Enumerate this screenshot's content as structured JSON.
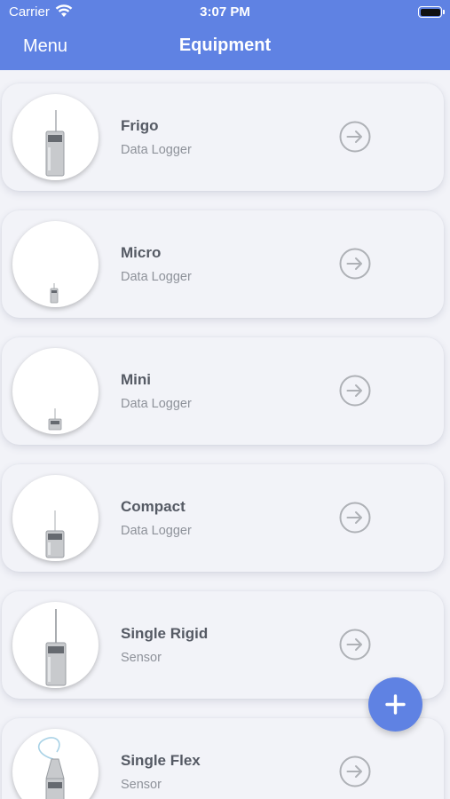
{
  "status_bar": {
    "carrier": "Carrier",
    "time": "3:07 PM"
  },
  "header": {
    "menu_label": "Menu",
    "title": "Equipment"
  },
  "theme": {
    "accent": "#5f82e3",
    "text_primary": "#555a64",
    "text_secondary": "#8e929a"
  },
  "equipment": [
    {
      "name": "Frigo",
      "type": "Data Logger",
      "image": "frigo-logger-image"
    },
    {
      "name": "Micro",
      "type": "Data Logger",
      "image": "micro-logger-image"
    },
    {
      "name": "Mini",
      "type": "Data Logger",
      "image": "mini-logger-image"
    },
    {
      "name": "Compact",
      "type": "Data Logger",
      "image": "compact-logger-image"
    },
    {
      "name": "Single Rigid",
      "type": "Sensor",
      "image": "single-rigid-sensor-image"
    },
    {
      "name": "Single Flex",
      "type": "Sensor",
      "image": "single-flex-sensor-image"
    }
  ],
  "icons": {
    "row_arrow": "arrow-right-circle-icon",
    "fab": "plus-icon",
    "wifi": "wifi-icon",
    "battery": "battery-icon"
  }
}
